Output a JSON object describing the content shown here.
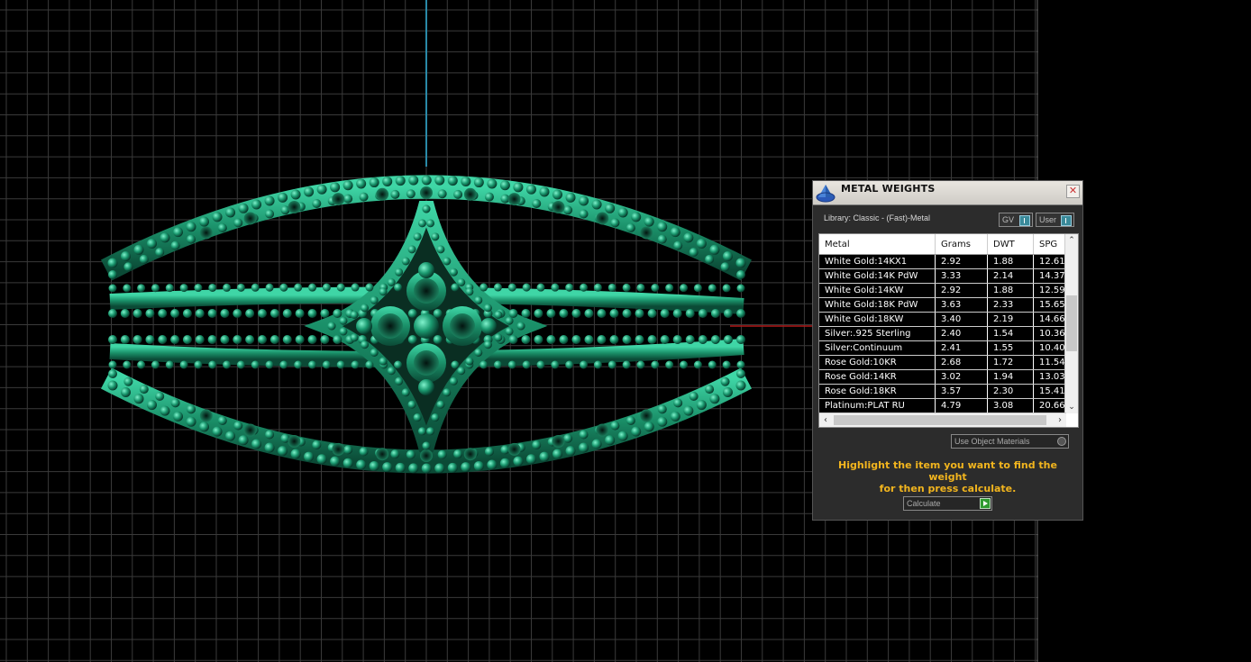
{
  "panel": {
    "title": "METAL WEIGHTS",
    "close_label": "✕",
    "library_label": "Library: Classic - (Fast)-Metal",
    "toggle_gv": "GV",
    "toggle_user": "User",
    "columns": [
      "Metal",
      "Grams",
      "DWT",
      "SPG"
    ],
    "rows": [
      {
        "metal": "White Gold:14KX1",
        "grams": "2.92",
        "dwt": "1.88",
        "spg": "12.61"
      },
      {
        "metal": "White Gold:14K PdW",
        "grams": "3.33",
        "dwt": "2.14",
        "spg": "14.37"
      },
      {
        "metal": "White Gold:14KW",
        "grams": "2.92",
        "dwt": "1.88",
        "spg": "12.59"
      },
      {
        "metal": "White Gold:18K PdW",
        "grams": "3.63",
        "dwt": "2.33",
        "spg": "15.65"
      },
      {
        "metal": "White Gold:18KW",
        "grams": "3.40",
        "dwt": "2.19",
        "spg": "14.66"
      },
      {
        "metal": "Silver:.925 Sterling",
        "grams": "2.40",
        "dwt": "1.54",
        "spg": "10.36"
      },
      {
        "metal": "Silver:Continuum",
        "grams": "2.41",
        "dwt": "1.55",
        "spg": "10.40"
      },
      {
        "metal": "Rose Gold:10KR",
        "grams": "2.68",
        "dwt": "1.72",
        "spg": "11.54"
      },
      {
        "metal": "Rose Gold:14KR",
        "grams": "3.02",
        "dwt": "1.94",
        "spg": "13.03"
      },
      {
        "metal": "Rose Gold:18KR",
        "grams": "3.57",
        "dwt": "2.30",
        "spg": "15.41"
      },
      {
        "metal": "Platinum:PLAT RU",
        "grams": "4.79",
        "dwt": "3.08",
        "spg": "20.66"
      }
    ],
    "use_object_materials": "Use Object Materials",
    "hint_line1": "Highlight the item you want to find the weight",
    "hint_line2": "for then press calculate.",
    "calculate_label": "Calculate"
  },
  "colors": {
    "model_green": "#1f9c74",
    "grid_line": "#3a3a3a",
    "axis_blue": "#2a8aa8",
    "axis_red": "#b01818",
    "hint_yellow": "#f2b51e"
  }
}
